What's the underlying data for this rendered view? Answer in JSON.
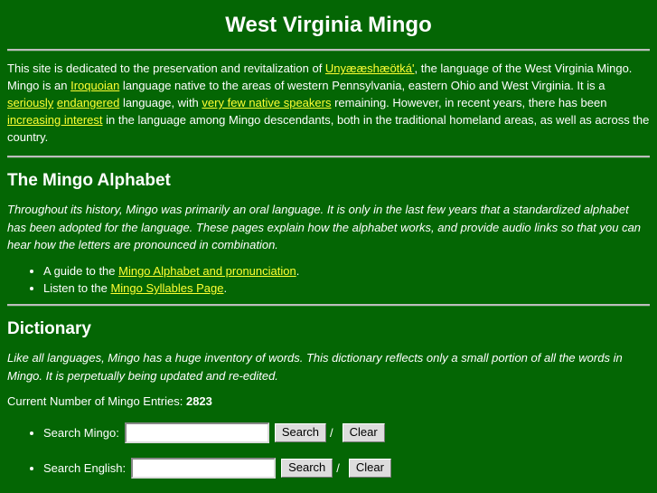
{
  "theme": {
    "background": "#046604",
    "text_color": "#ffffff",
    "link_color": "#ffff33",
    "rule_color": "#bdbdbd",
    "button_face": "#dddddd"
  },
  "header": {
    "title": "West Virginia Mingo"
  },
  "intro": {
    "part1": "This site is dedicated to the preservation and revitalization of ",
    "link_language": "Unyææshæötká'",
    "part2": ", the language of the West Virginia Mingo. Mingo is an ",
    "link_iroquoian": "Iroquoian",
    "part3": " language native to the areas of western Pennsylvania, eastern Ohio and West Virginia.  It is a ",
    "link_seriously": "seriously",
    "part4": " ",
    "link_endangered": "endangered",
    "part5": " language, with ",
    "link_few_speakers": "very few native speakers",
    "part6": " remaining.  However, in recent years, there has been ",
    "link_increasing_interest": "increasing interest",
    "part7": " in the language among Mingo descendants, both in the traditional homeland areas, as well as across the country."
  },
  "alphabet": {
    "heading": "The Mingo Alphabet",
    "blurb": "Throughout its history, Mingo was primarily an oral language.  It is only in the last few years that a standardized alphabet has been adopted for the language.  These pages explain how the alphabet works, and provide audio links so that you can hear how the letters are pronounced in combination.",
    "bullets": [
      {
        "prefix": "A guide to the ",
        "link": "Mingo Alphabet and pronunciation",
        "suffix": "."
      },
      {
        "prefix": "Listen to the ",
        "link": "Mingo Syllables Page",
        "suffix": "."
      }
    ]
  },
  "dictionary": {
    "heading": "Dictionary",
    "blurb": "Like all languages, Mingo has a huge inventory of words.  This dictionary reflects only a small portion of all the words in Mingo.  It is perpetually being updated and re-edited.",
    "count_label": "Current Number of Mingo Entries: ",
    "count_value": "2823",
    "searches": [
      {
        "label": "Search Mingo:",
        "input_value": "",
        "input_placeholder": "",
        "search_button": "Search",
        "separator": "/",
        "clear_button": "Clear"
      },
      {
        "label": "Search English:",
        "input_value": "",
        "input_placeholder": "",
        "search_button": "Search",
        "separator": "/",
        "clear_button": "Clear"
      }
    ]
  }
}
